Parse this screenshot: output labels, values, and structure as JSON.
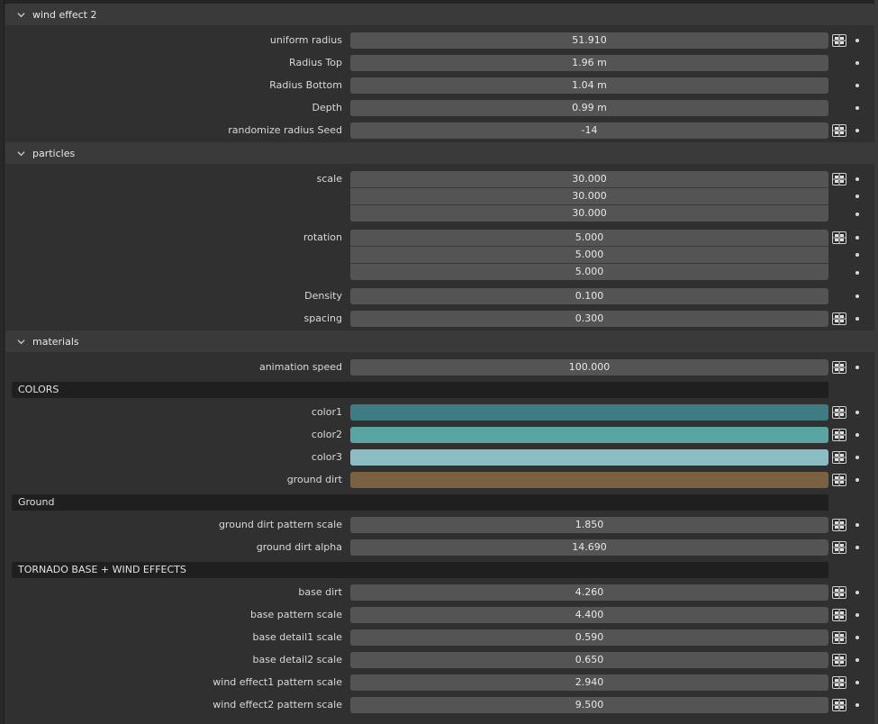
{
  "panels": {
    "wind_effect_2": {
      "title": "wind effect 2",
      "uniform_radius": {
        "label": "uniform radius",
        "value": "51.910"
      },
      "radius_top": {
        "label": "Radius Top",
        "value": "1.96 m"
      },
      "radius_bottom": {
        "label": "Radius Bottom",
        "value": "1.04 m"
      },
      "depth": {
        "label": "Depth",
        "value": "0.99 m"
      },
      "randomize_seed": {
        "label": "randomize radius Seed",
        "value": "-14"
      }
    },
    "particles": {
      "title": "particles",
      "scale": {
        "label": "scale",
        "values": [
          "30.000",
          "30.000",
          "30.000"
        ]
      },
      "rotation": {
        "label": "rotation",
        "values": [
          "5.000",
          "5.000",
          "5.000"
        ]
      },
      "density": {
        "label": "Density",
        "value": "0.100"
      },
      "spacing": {
        "label": "spacing",
        "value": "0.300"
      }
    },
    "materials": {
      "title": "materials",
      "animation_speed": {
        "label": "animation speed",
        "value": "100.000"
      },
      "colors_heading": "COLORS",
      "color1": {
        "label": "color1",
        "color": "#3f7b83"
      },
      "color2": {
        "label": "color2",
        "color": "#5aa4a4"
      },
      "color3": {
        "label": "color3",
        "color": "#8cbcc4"
      },
      "ground_dirt_color": {
        "label": "ground dirt",
        "color": "#7a6140"
      },
      "ground_heading": "Ground",
      "ground_dirt_pattern_scale": {
        "label": "ground dirt pattern scale",
        "value": "1.850"
      },
      "ground_dirt_alpha": {
        "label": "ground dirt alpha",
        "value": "14.690"
      },
      "tornado_heading": "TORNADO BASE + WIND EFFECTS",
      "base_dirt": {
        "label": "base dirt",
        "value": "4.260"
      },
      "base_pattern_scale": {
        "label": "base pattern scale",
        "value": "4.400"
      },
      "base_detail1_scale": {
        "label": "base detail1 scale",
        "value": "0.590"
      },
      "base_detail2_scale": {
        "label": "base detail2 scale",
        "value": "0.650"
      },
      "wind_effect1_pattern_scale": {
        "label": "wind effect1 pattern scale",
        "value": "2.940"
      },
      "wind_effect2_pattern_scale": {
        "label": "wind effect2 pattern scale",
        "value": "9.500"
      }
    }
  },
  "icons": {
    "panel_toggle": "chevron-down-icon",
    "driver": "node-socket-icon",
    "keyframe": "keyframe-dot-icon"
  },
  "colors": {
    "panel_bg": "#303030",
    "header_bg": "#3a3a3a",
    "field_bg": "#545454",
    "subhead_bg": "#1f1f1f"
  }
}
